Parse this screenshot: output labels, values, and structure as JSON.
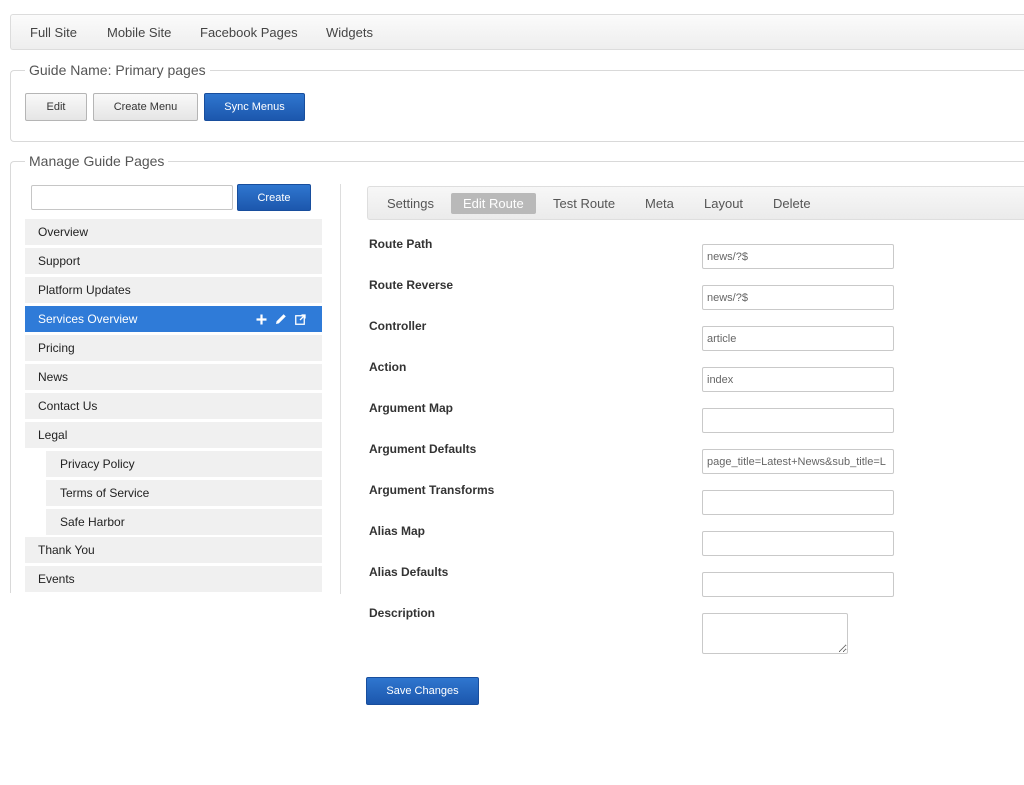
{
  "topnav": {
    "items": [
      "Full Site",
      "Mobile Site",
      "Facebook Pages",
      "Widgets"
    ]
  },
  "guide": {
    "legend": "Guide Name: Primary pages",
    "buttons": {
      "edit": "Edit",
      "create_menu": "Create Menu",
      "sync_menus": "Sync Menus"
    }
  },
  "manage": {
    "legend": "Manage Guide Pages",
    "search": {
      "value": "",
      "placeholder": ""
    },
    "create_label": "Create",
    "pages": [
      "Overview",
      "Support",
      "Platform Updates",
      "Services Overview",
      "Pricing",
      "News",
      "Contact Us",
      "Legal",
      "Privacy Policy",
      "Terms of Service",
      "Safe Harbor",
      "Thank You",
      "Events"
    ],
    "active_page": "Services Overview",
    "row_action_icons": [
      "plus-icon",
      "pencil-icon",
      "external-link-icon"
    ]
  },
  "tabs": {
    "items": [
      "Settings",
      "Edit Route",
      "Test Route",
      "Meta",
      "Layout",
      "Delete"
    ],
    "active": "Edit Route"
  },
  "form": {
    "fields": [
      {
        "label": "Route Path",
        "value": "news/?$"
      },
      {
        "label": "Route Reverse",
        "value": "news/?$"
      },
      {
        "label": "Controller",
        "value": "article"
      },
      {
        "label": "Action",
        "value": "index"
      },
      {
        "label": "Argument Map",
        "value": ""
      },
      {
        "label": "Argument Defaults",
        "value": "page_title=Latest+News&sub_title=L"
      },
      {
        "label": "Argument Transforms",
        "value": ""
      },
      {
        "label": "Alias Map",
        "value": ""
      },
      {
        "label": "Alias Defaults",
        "value": ""
      },
      {
        "label": "Description",
        "value": ""
      }
    ],
    "save_label": "Save Changes"
  },
  "colors": {
    "primary_blue": "#1c57ad",
    "active_row": "#2f7bd8",
    "active_tab": "#b9b9b9"
  }
}
